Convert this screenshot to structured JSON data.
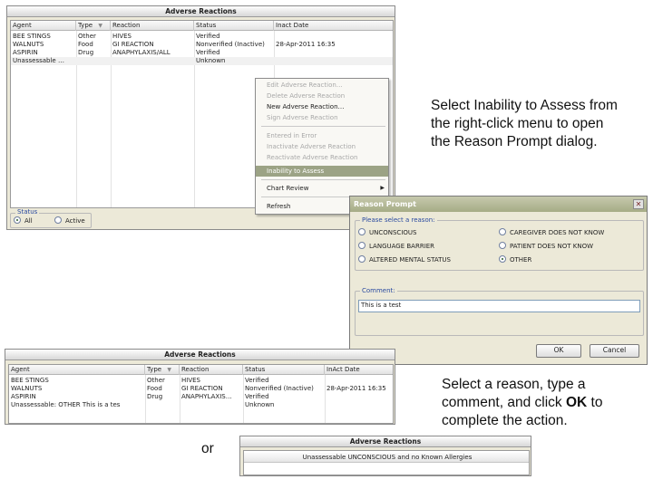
{
  "top_panel": {
    "title": "Adverse Reactions",
    "columns": [
      "Agent",
      "Type",
      "Reaction",
      "Status",
      "Inact Date"
    ],
    "sort_icon": "triangle-down",
    "rows": [
      {
        "agent": "BEE STINGS",
        "type": "Other",
        "reaction": "HIVES",
        "status": "Verified",
        "date": ""
      },
      {
        "agent": "WALNUTS",
        "type": "Food",
        "reaction": "GI REACTION",
        "status": "Nonverified (Inactive)",
        "date": "28-Apr-2011 16:35"
      },
      {
        "agent": "ASPIRIN",
        "type": "Drug",
        "reaction": "ANAPHYLAXIS/ALL",
        "status": "Verified",
        "date": ""
      },
      {
        "agent": "Unassessable …",
        "type": "",
        "reaction": "",
        "status": "Unknown",
        "date": ""
      }
    ],
    "status_group": {
      "label": "Status",
      "options": [
        "All",
        "Active"
      ],
      "selected": "All"
    }
  },
  "context_menu": {
    "items": [
      {
        "label": "Edit Adverse Reaction…",
        "disabled": true
      },
      {
        "label": "Delete Adverse Reaction",
        "disabled": true
      },
      {
        "label": "New Adverse Reaction…",
        "disabled": false
      },
      {
        "label": "Sign Adverse Reaction",
        "disabled": true
      },
      {
        "label": "Entered in Error",
        "disabled": true
      },
      {
        "label": "Inactivate Adverse Reaction",
        "disabled": true
      },
      {
        "label": "Reactivate Adverse Reaction",
        "disabled": true
      },
      {
        "label": "Inability to Assess",
        "disabled": false,
        "selected": true
      },
      {
        "label": "Chart Review",
        "disabled": false,
        "submenu": true
      },
      {
        "label": "Refresh",
        "disabled": false
      }
    ],
    "selected_color": "#9ca385"
  },
  "instruction_1": "Select Inability to Assess from the right-click menu to open the Reason Prompt dialog.",
  "reason_dialog": {
    "title": "Reason Prompt",
    "close_icon": "close-x",
    "reason_group_label": "Please select a reason:",
    "reasons_left": [
      "UNCONSCIOUS",
      "LANGUAGE BARRIER",
      "ALTERED MENTAL STATUS"
    ],
    "reasons_right": [
      "CAREGIVER DOES NOT KNOW",
      "PATIENT DOES NOT KNOW",
      "OTHER"
    ],
    "selected_reason": "OTHER",
    "comment_label": "Comment:",
    "comment_value": "This is a test",
    "ok_label": "OK",
    "cancel_label": "Cancel"
  },
  "bottom_panel": {
    "title": "Adverse Reactions",
    "columns": [
      "Agent",
      "Type",
      "Reaction",
      "Status",
      "InAct Date"
    ],
    "rows": [
      {
        "agent": "BEE STINGS",
        "type": "Other",
        "reaction": "HIVES",
        "status": "Verified",
        "date": ""
      },
      {
        "agent": "WALNUTS",
        "type": "Food",
        "reaction": "GI REACTION",
        "status": "Nonverified (Inactive)",
        "date": "28-Apr-2011 16:35"
      },
      {
        "agent": "ASPIRIN",
        "type": "Drug",
        "reaction": "ANAPHYLAXIS…",
        "status": "Verified",
        "date": ""
      },
      {
        "agent": "Unassessable: OTHER This is a tes",
        "type": "",
        "reaction": "",
        "status": "Unknown",
        "date": ""
      }
    ]
  },
  "instruction_2_pre": "Select a reason, type a comment, and click ",
  "instruction_2_bold": "OK",
  "instruction_2_post": " to complete the action.",
  "or_label": "or",
  "small_panel": {
    "title": "Adverse Reactions",
    "row": "Unassessable UNCONSCIOUS and no Known Allergies"
  }
}
